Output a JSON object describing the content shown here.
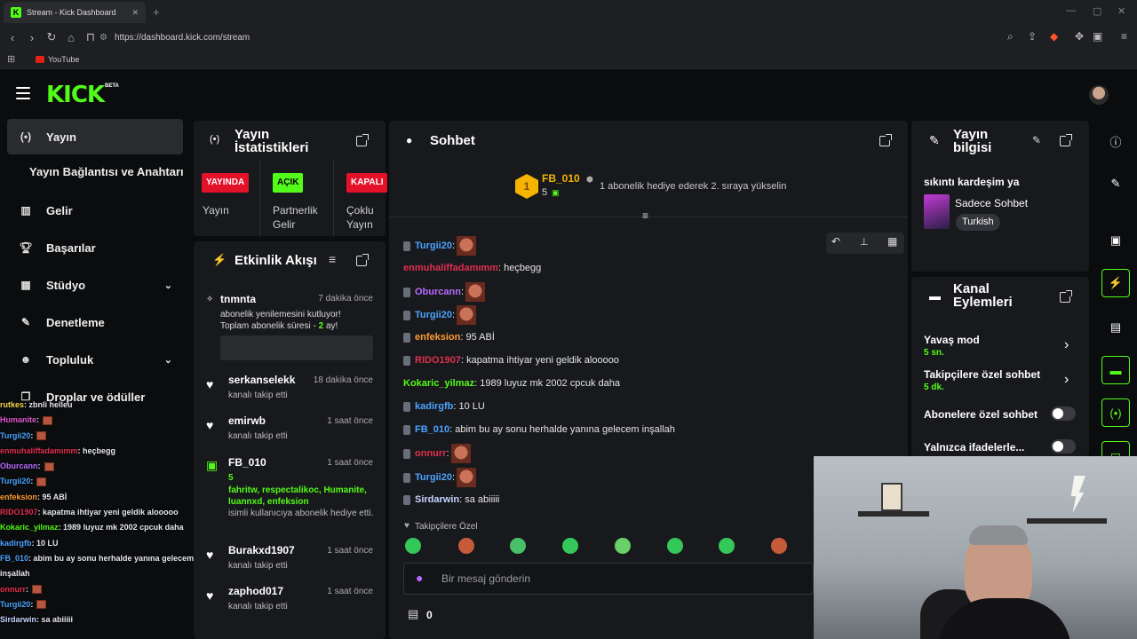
{
  "browser": {
    "tab_title": "Stream - Kick Dashboard",
    "url": "https://dashboard.kick.com/stream",
    "bookmark": "YouTube"
  },
  "brand": {
    "logo": "KICK",
    "beta": "BETA"
  },
  "sidebar": {
    "items": [
      {
        "label": "Yayın",
        "icon": "broadcast-icon"
      },
      {
        "label": "Yayın Bağlantısı ve Anahtarı"
      },
      {
        "label": "Gelir",
        "icon": "chart-icon"
      },
      {
        "label": "Başarılar",
        "icon": "trophy-icon"
      },
      {
        "label": "Stüdyo",
        "icon": "studio-icon"
      },
      {
        "label": "Denetleme",
        "icon": "wrench-icon"
      },
      {
        "label": "Topluluk",
        "icon": "people-icon"
      },
      {
        "label": "Droplar ve ödüller",
        "icon": "gift-icon"
      }
    ]
  },
  "overlay_chat": [
    {
      "user": "rutkes",
      "text": ": zbnli helleu",
      "color": "#f5d94a"
    },
    {
      "user": "Humanite",
      "text": ":",
      "color": "#e05ad0"
    },
    {
      "user": "Turgii20",
      "text": ":",
      "color": "#4aa3ff"
    },
    {
      "user": "enmuhaliffadamımm",
      "text": ": heçbegg",
      "color": "#e02f4f"
    },
    {
      "user": "Oburcann",
      "text": ":",
      "color": "#b66bff"
    },
    {
      "user": "Turgii20",
      "text": ":",
      "color": "#4aa3ff"
    },
    {
      "user": "enfeksion",
      "text": ": 95 ABİ",
      "color": "#ff9c33"
    },
    {
      "user": "RIDO1907",
      "text": ": kapatma ihtiyar yeni geldik alooooo",
      "color": "#e02f4f"
    },
    {
      "user": "Kokaric_yilmaz",
      "text": ": 1989 luyuz mk 2002 cpcuk daha",
      "color": "#53fc18"
    },
    {
      "user": "kadirgfb",
      "text": ": 10 LU",
      "color": "#4aa3ff"
    },
    {
      "user": "FB_010",
      "text": ": abim bu ay sonu herhalde yanına gelecem inşallah",
      "color": "#4aa3ff"
    },
    {
      "user": "onnurr",
      "text": ":",
      "color": "#e02f4f"
    },
    {
      "user": "Turgii20",
      "text": ":",
      "color": "#4aa3ff"
    },
    {
      "user": "Sirdarwin",
      "text": ": sa abiiiii",
      "color": "#c6d4ff"
    }
  ],
  "stats": {
    "title": "Yayın İstatistikleri",
    "badges": [
      {
        "text": "YAYINDA",
        "label": "Yayın",
        "bg": "#e3122a",
        "fg": "#ffffff"
      },
      {
        "text": "AÇIK",
        "label": "Partnerlik Gelir",
        "bg": "#53fc18",
        "fg": "#000000"
      },
      {
        "text": "KAPALI",
        "label": "Çoklu Yayın",
        "bg": "#e3122a",
        "fg": "#ffffff"
      }
    ]
  },
  "activity": {
    "title": "Etkinlik Akışı",
    "items": [
      {
        "name": "tnmnta",
        "time": "7 dakika önce",
        "line1": "abonelik yenilemesini kutluyor!",
        "line2": "Toplam abonelik süresi - ",
        "months": "2",
        "line2b": " ay!",
        "icon": "subscribe-icon"
      },
      {
        "name": "serkanselekk",
        "time": "18 dakika önce",
        "sub": "kanalı takip etti",
        "icon": "heart-icon"
      },
      {
        "name": "emirwb",
        "time": "1 saat önce",
        "sub": "kanalı takip etti",
        "icon": "heart-icon"
      },
      {
        "name": "FB_010",
        "time": "1 saat önce",
        "count": "5",
        "recipients": "fahritw, respectalikoc, Humanite, luannxd, enfeksion",
        "sub": "isimli kullanıcıya abonelik hediye etti.",
        "icon": "gift-icon"
      },
      {
        "name": "Burakxd1907",
        "time": "1 saat önce",
        "sub": "kanalı takip etti",
        "icon": "heart-icon"
      },
      {
        "name": "zaphod017",
        "time": "1 saat önce",
        "sub": "kanalı takip etti",
        "icon": "heart-icon"
      }
    ]
  },
  "chat": {
    "title": "Sohbet",
    "top_gifter": {
      "rank": "1",
      "name": "FB_010",
      "count": "5",
      "promo": "1 abonelik hediye ederek 2. sıraya yükselin"
    },
    "messages": [
      {
        "user": "Turgii20",
        "text": ":",
        "color": "#4aa3ff",
        "emote": true
      },
      {
        "user": "enmuhaliffadamımm",
        "text": ": heçbegg",
        "color": "#e02f4f"
      },
      {
        "user": "Oburcann",
        "text": ":",
        "color": "#b66bff",
        "emote": true
      },
      {
        "user": "Turgii20",
        "text": ":",
        "color": "#4aa3ff",
        "emote": true
      },
      {
        "user": "enfeksion",
        "text": ": 95 ABİ",
        "color": "#ff9c33"
      },
      {
        "user": "RIDO1907",
        "text": ": kapatma ihtiyar yeni geldik alooooo",
        "color": "#e02f4f"
      },
      {
        "user": "Kokaric_yilmaz",
        "text": ": 1989 luyuz mk 2002 cpcuk daha",
        "color": "#53fc18"
      },
      {
        "user": "kadirgfb",
        "text": ": 10 LU",
        "color": "#4aa3ff"
      },
      {
        "user": "FB_010",
        "text": ": abim bu ay sonu herhalde yanına gelecem inşallah",
        "color": "#4aa3ff"
      },
      {
        "user": "onnurr",
        "text": ":",
        "color": "#e02f4f",
        "emote": true
      },
      {
        "user": "Turgii20",
        "text": ":",
        "color": "#4aa3ff",
        "emote": true
      },
      {
        "user": "Sirdarwin",
        "text": ": sa abiiiii",
        "color": "#c6d4ff"
      }
    ],
    "followers_only_label": "Takipçilere Özel",
    "input_placeholder": "Bir mesaj gönderin",
    "points": "0"
  },
  "stream_info": {
    "title": "Yayın bilgisi",
    "stream_title": "sıkıntı kardeşim ya",
    "category": "Sadece Sohbet",
    "tag": "Turkish"
  },
  "channel_actions": {
    "title": "Kanal Eylemleri",
    "rows": [
      {
        "label": "Yavaş mod",
        "value": "5 sn."
      },
      {
        "label": "Takipçilere özel sohbet",
        "value": "5 dk."
      },
      {
        "label": "Abonelere özel sohbet"
      },
      {
        "label": "Yalnızca ifadelerle..."
      }
    ]
  },
  "colors": {
    "accent": "#53fc18",
    "live": "#e3122a",
    "panel": "#18191c"
  }
}
